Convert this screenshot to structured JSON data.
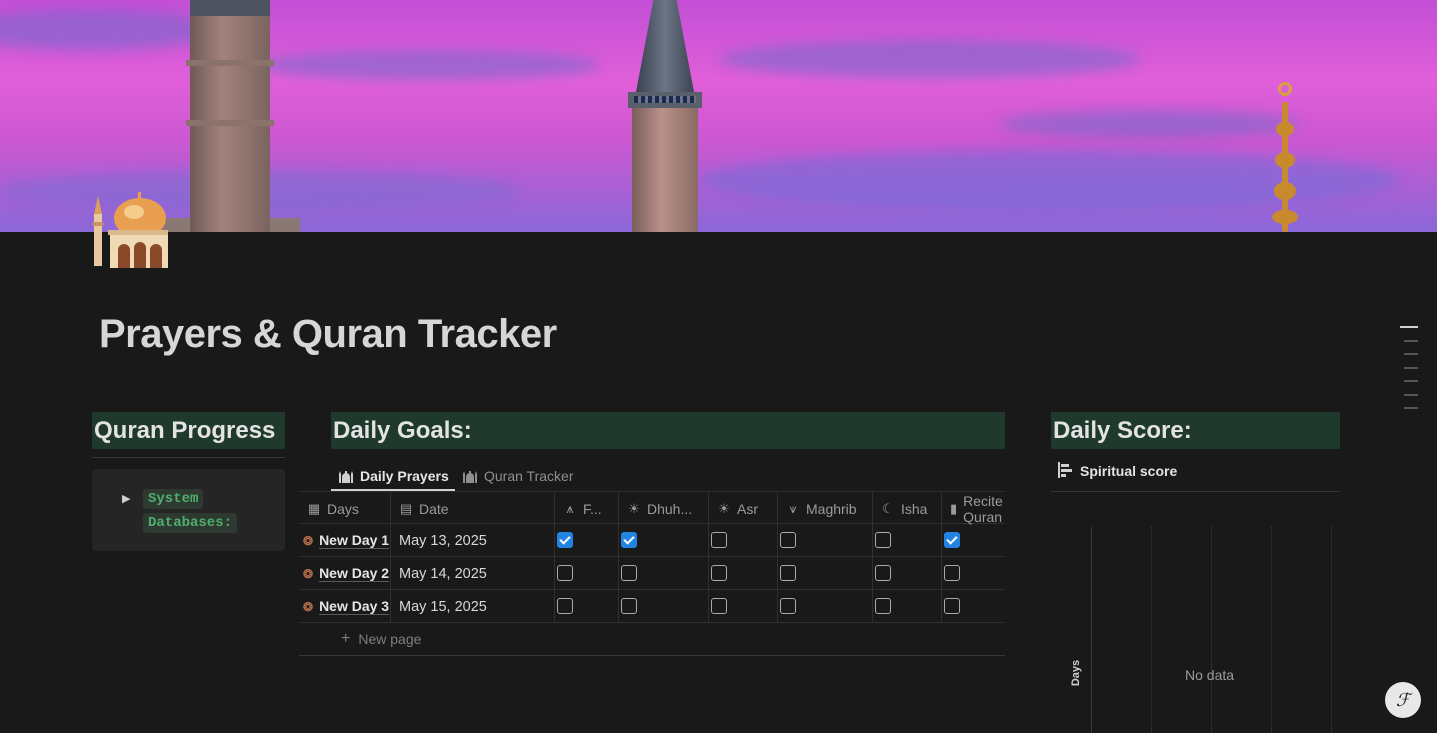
{
  "page": {
    "title": "Prayers & Quran Tracker"
  },
  "sections": {
    "quran_progress": {
      "heading": "Quran Progress",
      "toggle_text_1": "System",
      "toggle_text_2": "Databases:"
    },
    "daily_goals": {
      "heading": "Daily Goals:",
      "tabs": [
        {
          "label": "Daily Prayers",
          "active": true
        },
        {
          "label": "Quran Tracker",
          "active": false
        }
      ],
      "columns": [
        "Days",
        "Date",
        "F...",
        "Dhuh...",
        "Asr",
        "Maghrib",
        "Isha",
        "Recite Quran"
      ],
      "rows": [
        {
          "name": "New Day 1",
          "date": "May 13, 2025",
          "checks": [
            true,
            true,
            false,
            false,
            false,
            true
          ]
        },
        {
          "name": "New Day 2",
          "date": "May 14, 2025",
          "checks": [
            false,
            false,
            false,
            false,
            false,
            false
          ]
        },
        {
          "name": "New Day 3",
          "date": "May 15, 2025",
          "checks": [
            false,
            false,
            false,
            false,
            false,
            false
          ]
        }
      ],
      "new_page_label": "New page"
    },
    "daily_score": {
      "heading": "Daily Score:",
      "view_label": "Spiritual score",
      "chart": {
        "y_axis_label": "Days",
        "empty_text": "No data"
      }
    }
  },
  "help_button": {
    "label": "?"
  },
  "colors": {
    "heading_bg": "#1f3a2c",
    "checkbox_on": "#2383e2",
    "page_bg": "#191919"
  }
}
